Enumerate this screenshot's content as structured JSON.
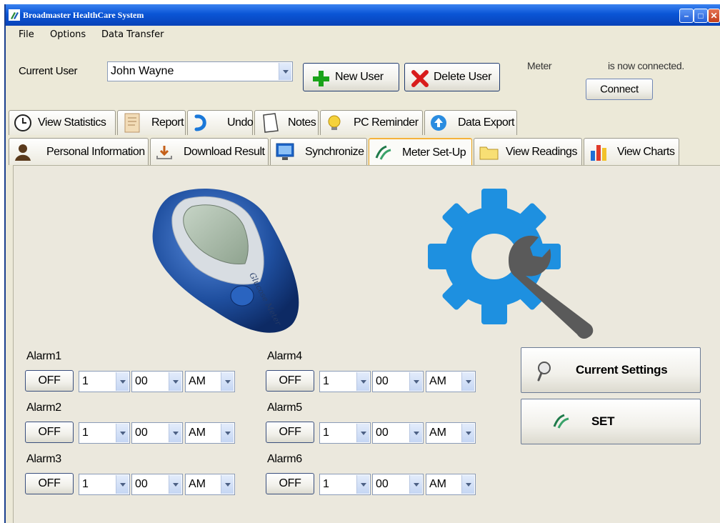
{
  "window": {
    "title": "Broadmaster HealthCare System"
  },
  "menu": [
    "File",
    "Options",
    "Data Transfer"
  ],
  "user": {
    "label": "Current User",
    "selected": "John Wayne",
    "new_user": "New User",
    "delete_user": "Delete User"
  },
  "meter": {
    "label": "Meter",
    "status": "is now connected.",
    "connect": "Connect"
  },
  "tabs_row1": [
    "View Statistics",
    "Report",
    "Undo",
    "Notes",
    "PC Reminder",
    "Data Export"
  ],
  "tabs_row2": [
    "Personal Information",
    "Download Result",
    "Synchronize",
    "Meter Set-Up",
    "View Readings",
    "View Charts"
  ],
  "active_tab": "Meter Set-Up",
  "device_brand": "Glucose Meter",
  "alarms": [
    {
      "label": "Alarm1",
      "state": "OFF",
      "hour": "1",
      "minute": "00",
      "ampm": "AM"
    },
    {
      "label": "Alarm2",
      "state": "OFF",
      "hour": "1",
      "minute": "00",
      "ampm": "AM"
    },
    {
      "label": "Alarm3",
      "state": "OFF",
      "hour": "1",
      "minute": "00",
      "ampm": "AM"
    },
    {
      "label": "Alarm4",
      "state": "OFF",
      "hour": "1",
      "minute": "00",
      "ampm": "AM"
    },
    {
      "label": "Alarm5",
      "state": "OFF",
      "hour": "1",
      "minute": "00",
      "ampm": "AM"
    },
    {
      "label": "Alarm6",
      "state": "OFF",
      "hour": "1",
      "minute": "00",
      "ampm": "AM"
    }
  ],
  "actions": {
    "current_settings": "Current Settings",
    "set": "SET"
  },
  "colors": {
    "titlebar": "#0a55d6",
    "gear": "#1e90e0",
    "wrench": "#5a5a5a",
    "meter_body": "#1f4f9f"
  }
}
